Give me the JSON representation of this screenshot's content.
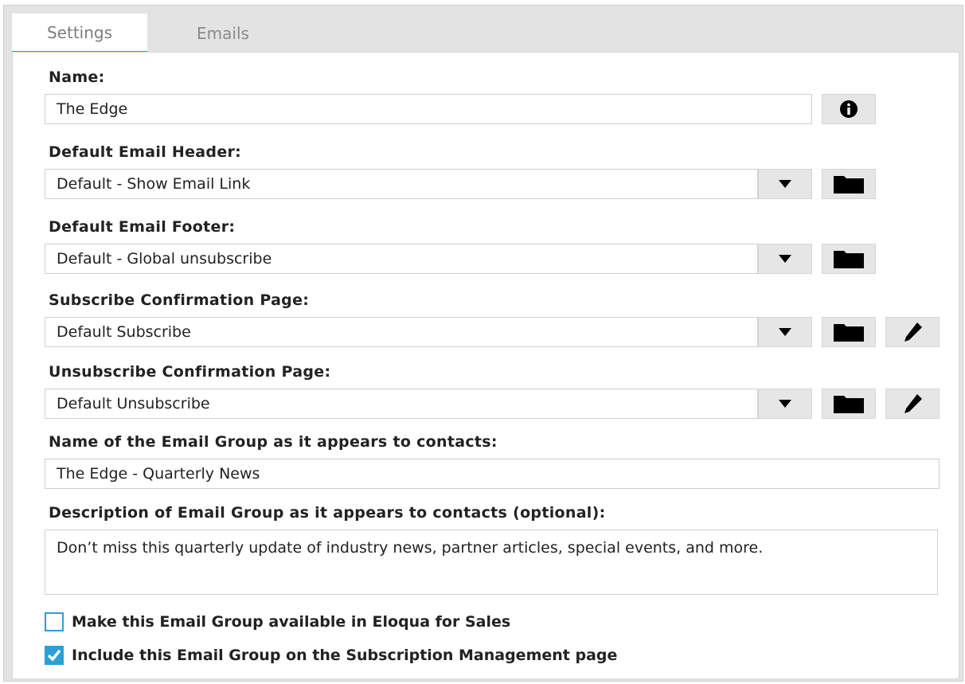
{
  "tabs": [
    {
      "label": "Settings",
      "active": true
    },
    {
      "label": "Emails",
      "active": false
    }
  ],
  "form": {
    "name_label": "Name:",
    "name_value": "The Edge",
    "header_label": "Default Email Header:",
    "header_value": "Default - Show Email Link",
    "footer_label": "Default Email Footer:",
    "footer_value": "Default - Global unsubscribe",
    "subscribe_label": "Subscribe Confirmation Page:",
    "subscribe_value": "Default Subscribe",
    "unsubscribe_label": "Unsubscribe Confirmation Page:",
    "unsubscribe_value": "Default Unsubscribe",
    "display_name_label": "Name of the Email Group as it appears to contacts:",
    "display_name_value": "The Edge - Quarterly News",
    "description_label": "Description of Email Group as it appears to contacts (optional):",
    "description_value": "Don’t miss this quarterly update of industry news, partner articles, special events, and more.",
    "checkbox_sales_label": "Make this Email Group available in Eloqua for Sales",
    "checkbox_sales_checked": false,
    "checkbox_subscription_label": "Include this Email Group on the Subscription Management page",
    "checkbox_subscription_checked": true
  },
  "icons": {
    "info": "info-icon",
    "dropdown": "caret-down-icon",
    "folder": "folder-icon",
    "edit": "pencil-icon"
  },
  "colors": {
    "accent": "#2c9fd6",
    "panel_bg": "#e3e3e3",
    "button_bg": "#e6e6e6"
  }
}
